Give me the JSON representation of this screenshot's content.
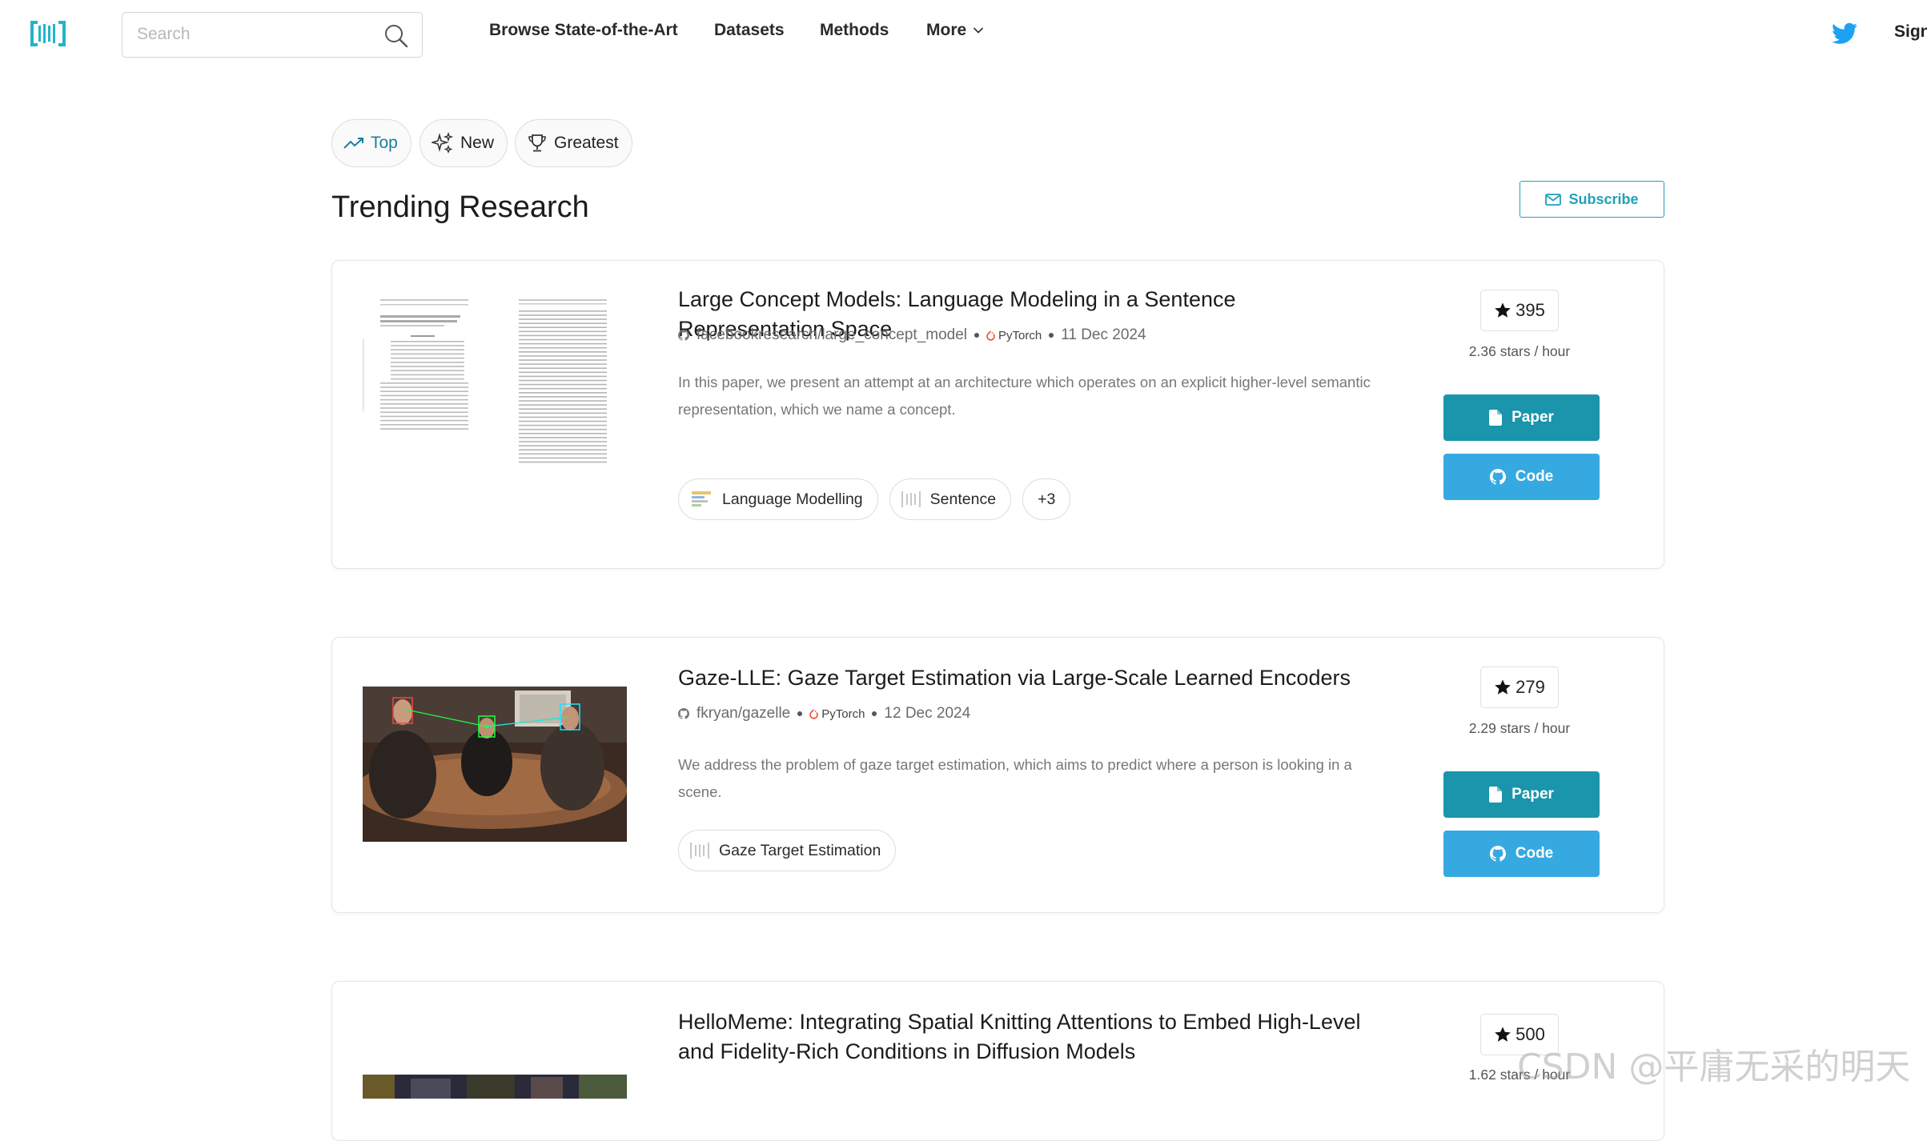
{
  "nav": {
    "search_placeholder": "Search",
    "links": [
      "Browse State-of-the-Art",
      "Datasets",
      "Methods",
      "More"
    ],
    "sign_in": "Sign"
  },
  "filters": {
    "top": "Top",
    "new": "New",
    "greatest": "Greatest",
    "active": "Top"
  },
  "page": {
    "title": "Trending Research",
    "subscribe": "Subscribe"
  },
  "papers": [
    {
      "title": "Large Concept Models: Language Modeling in a Sentence Representation Space",
      "repo": "facebookresearch/large_concept_model",
      "framework": "PyTorch",
      "date": "11 Dec 2024",
      "abstract": "In this paper, we present an attempt at an architecture which operates on an explicit higher-level semantic representation, which we name a concept.",
      "tags": [
        "Language Modelling",
        "Sentence"
      ],
      "more_tags": "+3",
      "stars": "395",
      "rate": "2.36 stars / hour",
      "paper_label": "Paper",
      "code_label": "Code"
    },
    {
      "title": "Gaze-LLE: Gaze Target Estimation via Large-Scale Learned Encoders",
      "repo": "fkryan/gazelle",
      "framework": "PyTorch",
      "date": "12 Dec 2024",
      "abstract": "We address the problem of gaze target estimation, which aims to predict where a person is looking in a scene.",
      "tags": [
        "Gaze Target Estimation"
      ],
      "stars": "279",
      "rate": "2.29 stars / hour",
      "paper_label": "Paper",
      "code_label": "Code"
    },
    {
      "title": "HelloMeme: Integrating Spatial Knitting Attentions to Embed High-Level and Fidelity-Rich Conditions in Diffusion Models",
      "stars": "500",
      "rate": "1.62 stars / hour"
    }
  ],
  "watermark": "CSDN @平庸无采的明天",
  "colors": {
    "accent": "#21a1b7",
    "paper_button": "#1a95ab",
    "code_button": "#36a9e1",
    "twitter": "#1da1f2",
    "pytorch": "#ee4c2c"
  }
}
